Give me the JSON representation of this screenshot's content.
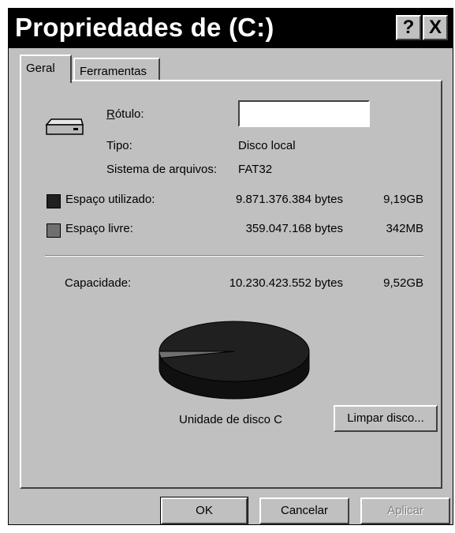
{
  "window": {
    "title": "Propriedades de  (C:)",
    "help_glyph": "?",
    "close_glyph": "X"
  },
  "tabs": [
    {
      "label": "Geral",
      "active": true
    },
    {
      "label": "Ferramentas",
      "active": false
    }
  ],
  "drive": {
    "icon": "hard-drive-icon",
    "label_caption": "Rótulo:",
    "label_value": "",
    "type_caption": "Tipo:",
    "type_value": "Disco local",
    "fs_caption": "Sistema de arquivos:",
    "fs_value": "FAT32"
  },
  "space": {
    "used": {
      "label": "Espaço utilizado:",
      "bytes": "9.871.376.384 bytes",
      "size": "9,19GB",
      "color": "#202020"
    },
    "free": {
      "label": "Espaço livre:",
      "bytes": "359.047.168 bytes",
      "size": "342MB",
      "color": "#707070"
    },
    "capacity": {
      "label": "Capacidade:",
      "bytes": "10.230.423.552 bytes",
      "size": "9,52GB"
    }
  },
  "chart_data": {
    "type": "pie",
    "categories": [
      "Espaço utilizado",
      "Espaço livre"
    ],
    "values": [
      9871376384,
      359047168
    ],
    "title": "",
    "colors": [
      "#202020",
      "#707070"
    ]
  },
  "drive_caption": "Unidade de disco C",
  "cleanup_button": "Limpar disco...",
  "buttons": {
    "ok": "OK",
    "cancel": "Cancelar",
    "apply": "Aplicar"
  }
}
